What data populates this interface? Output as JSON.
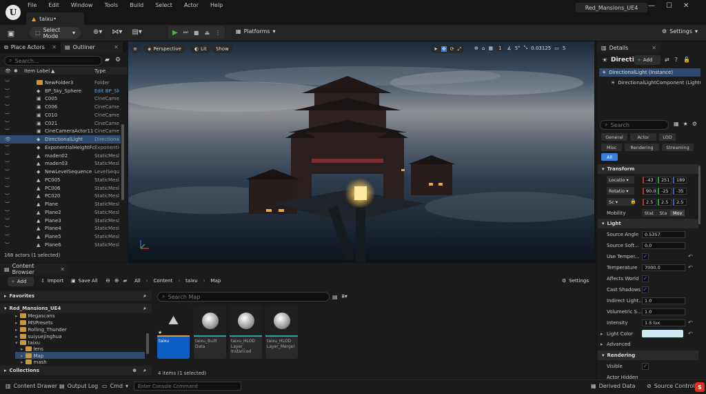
{
  "menu": [
    "File",
    "Edit",
    "Window",
    "Tools",
    "Build",
    "Select",
    "Actor",
    "Help"
  ],
  "project_title": "Red_Mansions_UE4",
  "level_tab": "taixu•",
  "toolbar": {
    "select_mode": "Select Mode",
    "platforms": "Platforms",
    "settings": "Settings"
  },
  "outliner": {
    "tabs": [
      "Place Actors",
      "Outliner"
    ],
    "search_placeholder": "Search...",
    "col_label": "Item Label",
    "col_type": "Type",
    "rows": [
      {
        "name": "NewFolder3",
        "type": "Folder"
      },
      {
        "name": "BP_Sky_Sphere",
        "type": "Edit BP_Sk"
      },
      {
        "name": "C005",
        "type": "CineCamer"
      },
      {
        "name": "C006",
        "type": "CineCamer"
      },
      {
        "name": "C010",
        "type": "CineCamer"
      },
      {
        "name": "C021",
        "type": "CineCamer"
      },
      {
        "name": "CineCameraActor11",
        "type": "CineCamer"
      },
      {
        "name": "DirectionalLight",
        "type": "Directional"
      },
      {
        "name": "ExponentialHeightFc",
        "type": "Exponentie"
      },
      {
        "name": "maden02",
        "type": "StaticMesl"
      },
      {
        "name": "maden03",
        "type": "StaticMesl"
      },
      {
        "name": "NewLevelSequence",
        "type": "LevelSequ"
      },
      {
        "name": "PC005",
        "type": "StaticMesl"
      },
      {
        "name": "PC006",
        "type": "StaticMesl"
      },
      {
        "name": "PC020",
        "type": "StaticMesl"
      },
      {
        "name": "Plane",
        "type": "StaticMesl"
      },
      {
        "name": "Plane2",
        "type": "StaticMesl"
      },
      {
        "name": "Plane3",
        "type": "StaticMesl"
      },
      {
        "name": "Plane4",
        "type": "StaticMesl"
      },
      {
        "name": "Plane5",
        "type": "StaticMesl"
      },
      {
        "name": "Plane6",
        "type": "StaticMesl"
      }
    ],
    "status": "168 actors (1 selected)"
  },
  "viewport": {
    "perspective": "Perspective",
    "lit": "Lit",
    "show": "Show",
    "grid": "1",
    "angle": "5°",
    "scale": "0.03125",
    "cam": "5"
  },
  "details": {
    "tab": "Details",
    "object_name": "Directio",
    "add": "Add",
    "components": [
      "DirectionalLight (Instance)",
      "DirectionalLightComponent (LightC"
    ],
    "search_placeholder": "Search",
    "filters": [
      "General",
      "Actor",
      "LOD",
      "Misc",
      "Rendering",
      "Streaming",
      "All"
    ],
    "transform_title": "Transform",
    "location_label": "Locatio",
    "location": [
      "-43",
      "251",
      "189"
    ],
    "rotation_label": "Rotatio",
    "rotation": [
      "90.0",
      "-25",
      "-35"
    ],
    "scale_label": "Sc",
    "scale": [
      "2.5",
      "2.5",
      "2.5"
    ],
    "mobility_label": "Mobility",
    "mobility": [
      "Stat",
      "Sta",
      "Mov"
    ],
    "light_title": "Light",
    "props": [
      {
        "label": "Source Angle",
        "value": "0.5357"
      },
      {
        "label": "Source Soft...",
        "value": "0.0"
      },
      {
        "label": "Use Temper...",
        "value": ""
      },
      {
        "label": "Temperature",
        "value": "7000.0"
      },
      {
        "label": "Affects World",
        "value": ""
      },
      {
        "label": "Cast Shadows",
        "value": ""
      },
      {
        "label": "Indirect Light...",
        "value": "1.0"
      },
      {
        "label": "Volumetric S...",
        "value": "1.0"
      },
      {
        "label": "Intensity",
        "value": "1.5 lux"
      },
      {
        "label": "Light Color",
        "value": ""
      }
    ],
    "advanced": "Advanced",
    "rendering_title": "Rendering",
    "visible": "Visible",
    "actor_hidden": "Actor Hidden"
  },
  "content_browser": {
    "tab": "Content Browser",
    "add": "Add",
    "import": "Import",
    "save_all": "Save All",
    "path": [
      "All",
      "Content",
      "taixu",
      "Map"
    ],
    "settings": "Settings",
    "favorites": "Favorites",
    "project": "Red_Mansions_UE4",
    "tree": [
      "Megascans",
      "MSPresets",
      "Rolling_Thunder",
      "suiyuejinghua",
      "taixu",
      "lens",
      "Map",
      "mash"
    ],
    "collections": "Collections",
    "search_placeholder": "Search Map",
    "assets": [
      {
        "name": "taixu"
      },
      {
        "name": "taixu_Built Data"
      },
      {
        "name": "taixu_HLOD Layer_ Instanced"
      },
      {
        "name": "taixu_HLOD Layer_Mergel"
      }
    ],
    "count": "4 items (1 selected)"
  },
  "statusbar": {
    "content_drawer": "Content Drawer",
    "output_log": "Output Log",
    "cmd": "Cmd",
    "console_placeholder": "Enter Console Command",
    "derived_data": "Derived Data",
    "source_control": "Source Control Off"
  },
  "colors": {
    "accent": "#3d7fd6",
    "selected_row": "#2f4a6e",
    "play_green": "#4caf50",
    "folder": "#c99a3a",
    "light_color": "#cfe9f2"
  }
}
